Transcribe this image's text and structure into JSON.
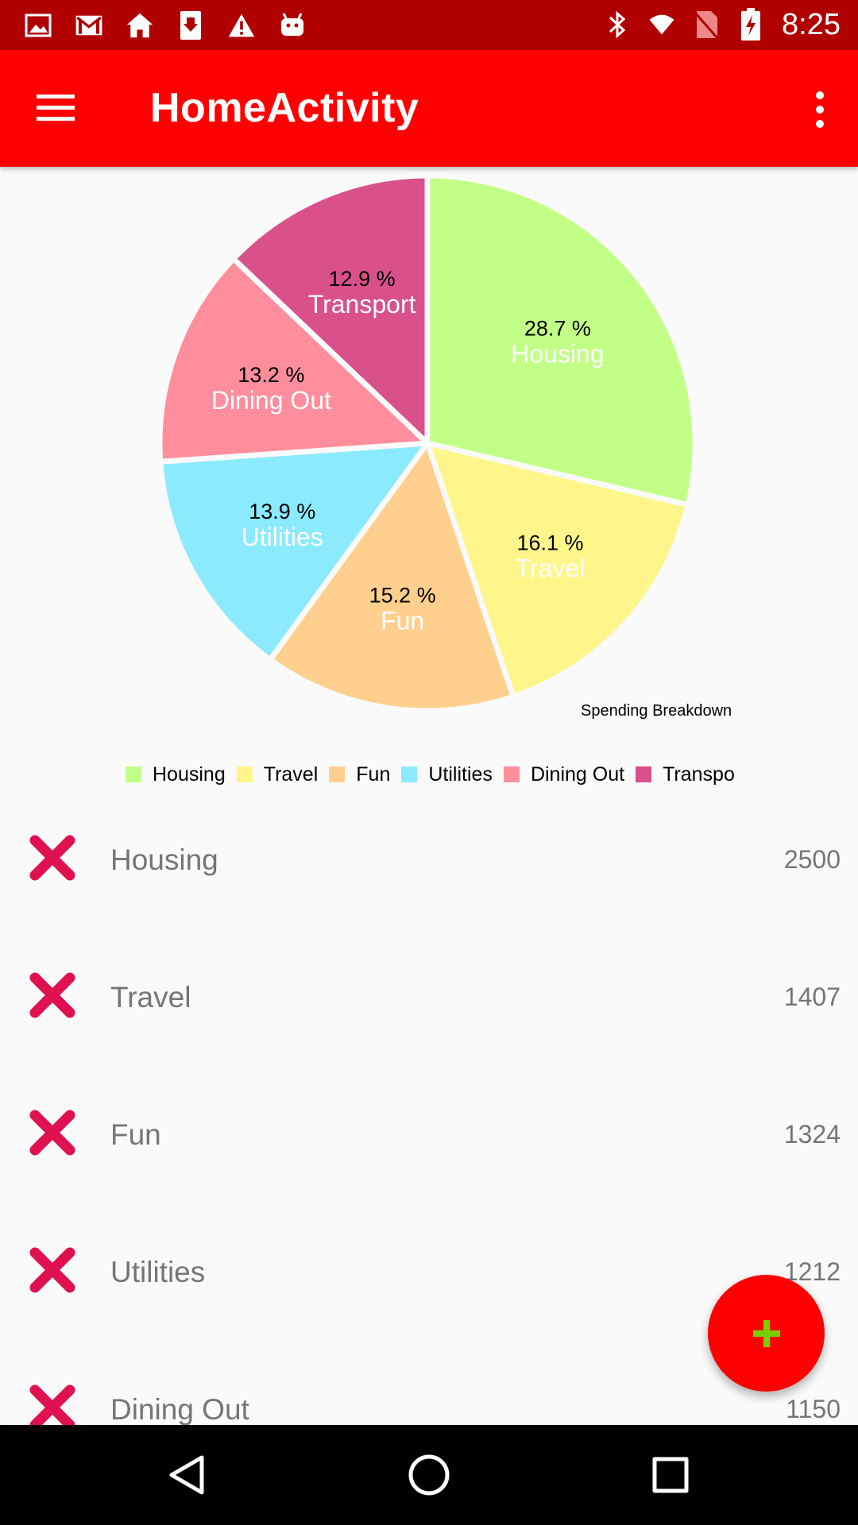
{
  "status_bar": {
    "time": "8:25",
    "left_icons": [
      "photo-icon",
      "gmail-icon",
      "home-icon",
      "download-icon",
      "warning-icon",
      "android-icon"
    ],
    "right_icons": [
      "bluetooth-icon",
      "wifi-icon",
      "no-sim-icon",
      "battery-charging-icon"
    ]
  },
  "app_bar": {
    "title": "HomeActivity",
    "menu_icon": "hamburger-menu-icon",
    "overflow_icon": "more-vert-icon"
  },
  "chart_data": {
    "type": "pie",
    "description": "Spending Breakdown",
    "categories": [
      "Housing",
      "Travel",
      "Fun",
      "Utilities",
      "Dining Out",
      "Transport"
    ],
    "values": [
      28.7,
      16.1,
      15.2,
      13.9,
      13.2,
      12.9
    ],
    "value_labels": [
      "28.7 %",
      "16.1 %",
      "15.2 %",
      "13.9 %",
      "13.2 %",
      "12.9 %"
    ],
    "colors": [
      "#c1ff86",
      "#fff68b",
      "#ffd08d",
      "#8ceaff",
      "#ff8e9c",
      "#d9508a"
    ],
    "legend": [
      "Housing",
      "Travel",
      "Fun",
      "Utilities",
      "Dining Out",
      "Transpo"
    ],
    "legend_position": "bottom-center"
  },
  "expenses": [
    {
      "name": "Housing",
      "amount": "2500"
    },
    {
      "name": "Travel",
      "amount": "1407"
    },
    {
      "name": "Fun",
      "amount": "1324"
    },
    {
      "name": "Utilities",
      "amount": "1212"
    },
    {
      "name": "Dining Out",
      "amount": "1150"
    }
  ],
  "colors": {
    "status_bar": "#b00000",
    "app_bar": "#ff0000",
    "fab": "#ff0000",
    "fab_icon": "#76d000",
    "delete_icon": "#e0114f",
    "nav_bar": "#000000"
  },
  "fab": {
    "icon": "plus-icon"
  },
  "nav_bar": {
    "icons": [
      "back-icon",
      "home-circle-icon",
      "recents-icon"
    ]
  }
}
